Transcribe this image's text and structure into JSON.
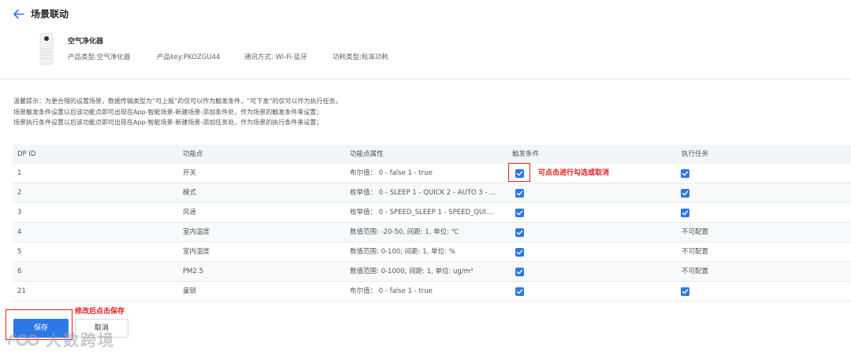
{
  "header": {
    "title": "场景联动"
  },
  "device": {
    "name": "空气净化器",
    "product_type": "产品类型:空气净化器",
    "product_key": "产品key:PKOZGU44",
    "comm_method": "通讯方式: Wi-Fi-蓝牙",
    "power_type": "功耗类型:标准功耗"
  },
  "notice": {
    "line1": "温馨提示：为更合理的设置场景，数据传输类型为“可上报”的仅可以作为触发条件，“可下发”的仅可以作为执行任务。",
    "line2": "场景触发条件设置以后该功能点即可出现在App-智能场景-新建场景-添加条件处，作为场景的触发条件来设置；",
    "line3": "场景执行条件设置以后该功能点即可出现在App-智能场景-新建场景-添加任务处，作为场景的执行条件来设置；"
  },
  "table": {
    "headers": {
      "dp_id": "DP ID",
      "function": "功能点",
      "attr": "功能点属性",
      "trigger": "触发条件",
      "exec": "执行任务"
    },
    "rows": [
      {
        "id": "1",
        "function": "开关",
        "attr": "布尔值： 0 - false 1 - true",
        "trigger": true,
        "exec": true,
        "exec_text": ""
      },
      {
        "id": "2",
        "function": "模式",
        "attr": "枚举值： 0 - SLEEP 1 - QUICK 2 - AUTO 3 - ...",
        "trigger": true,
        "exec": true,
        "exec_text": ""
      },
      {
        "id": "3",
        "function": "风速",
        "attr": "枚举值： 0 - SPEED_SLEEP 1 - SPEED_QUI...",
        "trigger": true,
        "exec": true,
        "exec_text": ""
      },
      {
        "id": "4",
        "function": "室内温度",
        "attr": "数值范围: -20-50, 间距: 1, 单位: ℃",
        "trigger": true,
        "exec": false,
        "exec_text": "不可配置"
      },
      {
        "id": "5",
        "function": "室内湿度",
        "attr": "数值范围: 0-100, 间距: 1, 单位: %",
        "trigger": true,
        "exec": false,
        "exec_text": "不可配置"
      },
      {
        "id": "6",
        "function": "PM2.5",
        "attr": "数值范围: 0-1000, 间距: 1, 单位: ug/m³",
        "trigger": true,
        "exec": false,
        "exec_text": "不可配置"
      },
      {
        "id": "21",
        "function": "童锁",
        "attr": "布尔值： 0 - false 1 - true",
        "trigger": true,
        "exec": true,
        "exec_text": ""
      }
    ]
  },
  "annotations": {
    "checkbox_tip": "可点击进行勾选或取消",
    "save_tip": "修改后点击保存"
  },
  "buttons": {
    "save": "保存",
    "cancel": "取消"
  },
  "watermark": {
    "text": "大数跨境"
  },
  "colors": {
    "accent": "#2e77e8",
    "annotation_red": "#e02020"
  },
  "icons": {
    "back": "arrow-left-icon",
    "checkbox": "check-icon"
  }
}
